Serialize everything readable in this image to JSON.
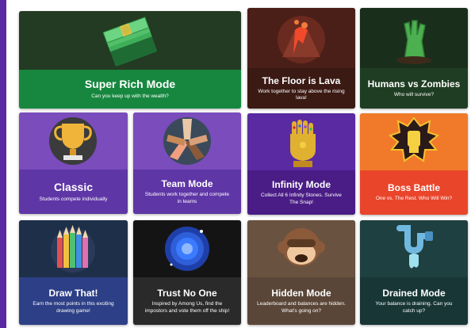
{
  "cards": [
    {
      "title": "Super Rich Mode",
      "desc": "Can you keep up with the wealth?",
      "icon": "cash-stack-icon",
      "color": "#17873f"
    },
    {
      "title": "The Floor is Lava",
      "desc": "Work together to stay above the rising lava!",
      "icon": "volcano-icon",
      "color": "#3b1a14"
    },
    {
      "title": "Humans vs Zombies",
      "desc": "Who will survive?",
      "icon": "zombie-hand-icon",
      "color": "#1f3d22"
    },
    {
      "title": "Classic",
      "desc": "Students compete individually",
      "icon": "trophy-icon",
      "color": "#5f36a6"
    },
    {
      "title": "Team Mode",
      "desc": "Students work together and compete in teams",
      "icon": "team-hands-icon",
      "color": "#5f36a6"
    },
    {
      "title": "Infinity Mode",
      "desc": "Collect All 6 Infinity Stones. Survive The Snap!",
      "icon": "gauntlet-icon",
      "color": "#4a1d86"
    },
    {
      "title": "Boss Battle",
      "desc": "One vs. The Rest. Who Will Win?",
      "icon": "fist-icon",
      "color": "#e9452b"
    },
    {
      "title": "Draw That!",
      "desc": "Earn the most points in this exciting drawing game!",
      "icon": "pencils-icon",
      "color": "#2d3f86"
    },
    {
      "title": "Trust No One",
      "desc": "Inspired by Among Us, find the impostors and vote them off the ship!",
      "icon": "portal-icon",
      "color": "#2a2a2a"
    },
    {
      "title": "Hidden Mode",
      "desc": "Leaderboard and balances are hidden. What's going on?",
      "icon": "monkey-icon",
      "color": "#5a4638"
    },
    {
      "title": "Drained Mode",
      "desc": "Your balance is draining. Can you catch up?",
      "icon": "pipe-icon",
      "color": "#183636"
    }
  ]
}
